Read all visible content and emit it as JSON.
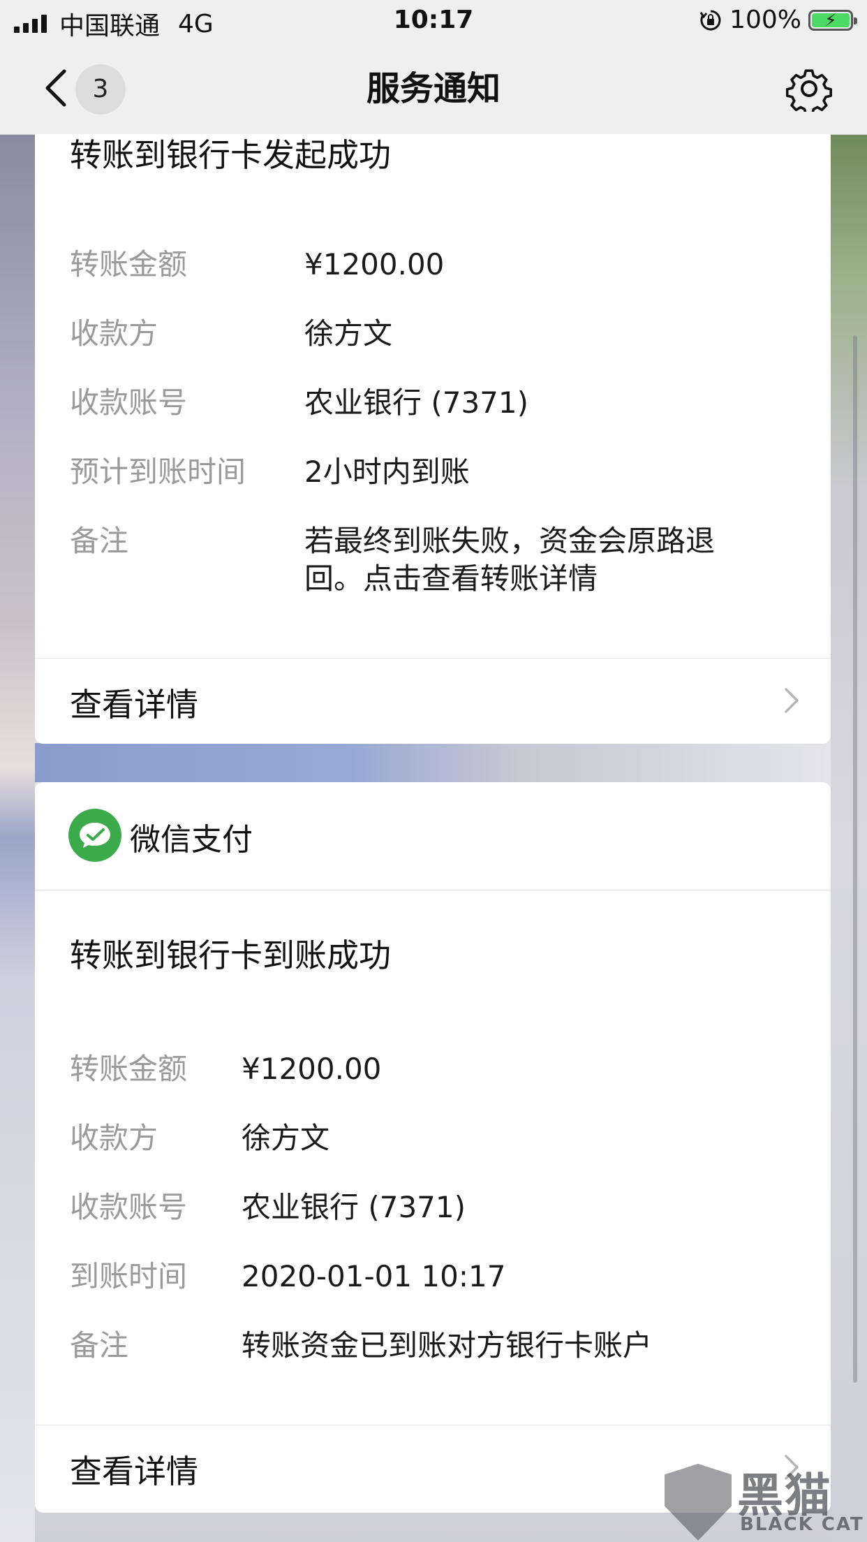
{
  "status_bar": {
    "carrier": "中国联通",
    "network": "4G",
    "time": "10:17",
    "battery": "100%"
  },
  "nav": {
    "back_count": "3",
    "title": "服务通知"
  },
  "card1": {
    "title": "转账到银行卡发起成功",
    "rows": [
      {
        "label": "转账金额",
        "value": "¥1200.00"
      },
      {
        "label": "收款方",
        "value": "徐方文"
      },
      {
        "label": "收款账号",
        "value": "农业银行 (7371)"
      },
      {
        "label": "预计到账时间",
        "value": "2小时内到账"
      },
      {
        "label": "备注",
        "value": "若最终到账失败，资金会原路退回。点击查看转账详情"
      }
    ],
    "details_label": "查看详情"
  },
  "card2": {
    "app_name": "微信支付",
    "title": "转账到银行卡到账成功",
    "rows": [
      {
        "label": "转账金额",
        "value": "¥1200.00"
      },
      {
        "label": "收款方",
        "value": "徐方文"
      },
      {
        "label": "收款账号",
        "value": "农业银行 (7371)"
      },
      {
        "label": "到账时间",
        "value": "2020-01-01 10:17"
      },
      {
        "label": "备注",
        "value": "转账资金已到账对方银行卡账户"
      }
    ],
    "details_label": "查看详情"
  },
  "watermark": {
    "text": "黑猫",
    "sub": "BLACK CAT"
  },
  "colors": {
    "wechat_pay_green": "#3aaa4a",
    "battery_green": "#4cd964",
    "label_gray": "#9a9a9a"
  }
}
